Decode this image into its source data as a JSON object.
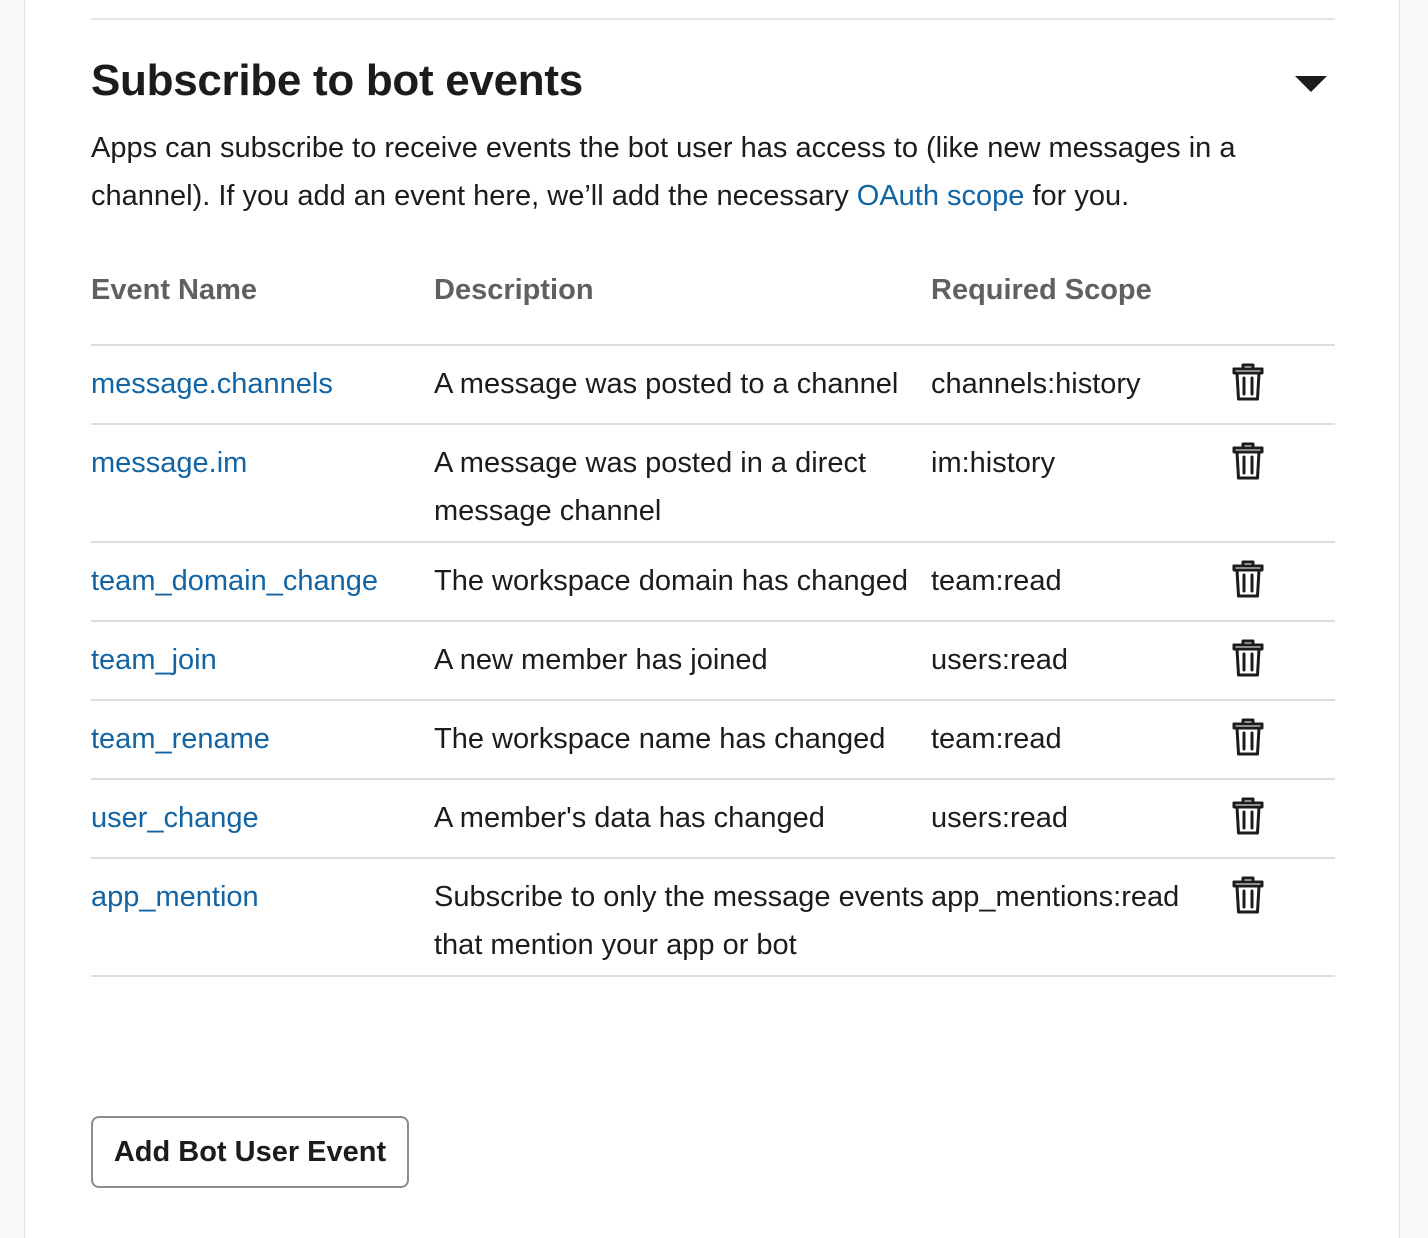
{
  "section": {
    "title": "Subscribe to bot events",
    "description_before_link": "Apps can subscribe to receive events the bot user has access to (like new messages in a channel). If you add an event here, we’ll add the necessary ",
    "description_link": "OAuth scope",
    "description_after_link": " for you.",
    "toggle_icon": "caret-down-icon"
  },
  "table": {
    "headers": {
      "event_name": "Event Name",
      "description": "Description",
      "required_scope": "Required Scope"
    },
    "rows": [
      {
        "name": "message.channels",
        "description": "A message was posted to a channel",
        "scope": "channels:history",
        "icon": "trash-icon"
      },
      {
        "name": "message.im",
        "description": "A message was posted in a direct message channel",
        "scope": "im:history",
        "icon": "trash-icon"
      },
      {
        "name": "team_domain_change",
        "description": "The workspace domain has changed",
        "scope": "team:read",
        "icon": "trash-icon"
      },
      {
        "name": "team_join",
        "description": "A new member has joined",
        "scope": "users:read",
        "icon": "trash-icon"
      },
      {
        "name": "team_rename",
        "description": "The workspace name has changed",
        "scope": "team:read",
        "icon": "trash-icon"
      },
      {
        "name": "user_change",
        "description": "A member's data has changed",
        "scope": "users:read",
        "icon": "trash-icon"
      },
      {
        "name": "app_mention",
        "description": "Subscribe to only the message events that mention your app or bot",
        "scope": "app_mentions:read",
        "icon": "trash-icon"
      }
    ]
  },
  "actions": {
    "add_label": "Add Bot User Event"
  },
  "colors": {
    "link": "#1264a3",
    "text": "#1d1c1d",
    "header_text": "#616061",
    "divider": "#dddddd"
  }
}
